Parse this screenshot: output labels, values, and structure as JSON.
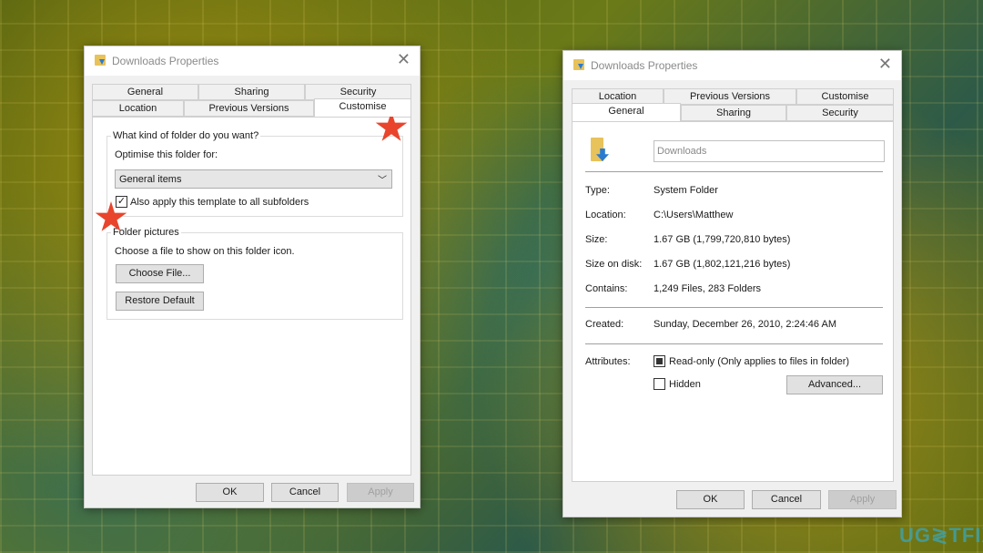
{
  "left_dialog": {
    "title": "Downloads Properties",
    "tabs_row1": [
      "General",
      "Sharing",
      "Security"
    ],
    "tabs_row2": [
      "Location",
      "Previous Versions",
      "Customise"
    ],
    "selected_tab": "Customise",
    "group1_label": "What kind of folder do you want?",
    "optimise_label": "Optimise this folder for:",
    "optimise_value": "General items",
    "apply_subfolders_label": "Also apply this template to all subfolders",
    "apply_subfolders_checked": true,
    "group2_label": "Folder pictures",
    "choose_text": "Choose a file to show on this folder icon.",
    "choose_file": "Choose File...",
    "restore_default": "Restore Default",
    "ok": "OK",
    "cancel": "Cancel",
    "apply": "Apply"
  },
  "right_dialog": {
    "title": "Downloads Properties",
    "tabs_row1": [
      "Location",
      "Previous Versions",
      "Customise"
    ],
    "tabs_row2": [
      "General",
      "Sharing",
      "Security"
    ],
    "selected_tab": "General",
    "name_value": "Downloads",
    "rows": [
      {
        "label": "Type:",
        "value": "System Folder"
      },
      {
        "label": "Location:",
        "value": "C:\\Users\\Matthew"
      },
      {
        "label": "Size:",
        "value": "1.67 GB (1,799,720,810 bytes)"
      },
      {
        "label": "Size on disk:",
        "value": "1.67 GB (1,802,121,216 bytes)"
      },
      {
        "label": "Contains:",
        "value": "1,249 Files, 283 Folders"
      }
    ],
    "created_label": "Created:",
    "created_value": "Sunday, December 26, 2010, 2:24:46 AM",
    "attributes_label": "Attributes:",
    "readonly_label": "Read-only (Only applies to files in folder)",
    "readonly_state": "indeterminate",
    "hidden_label": "Hidden",
    "hidden_checked": false,
    "advanced": "Advanced...",
    "ok": "OK",
    "cancel": "Cancel",
    "apply": "Apply"
  },
  "watermark": "UGETFIX",
  "colors": {
    "annotation_star": "#e8452c",
    "folder_arrow": "#2a7bd0"
  }
}
